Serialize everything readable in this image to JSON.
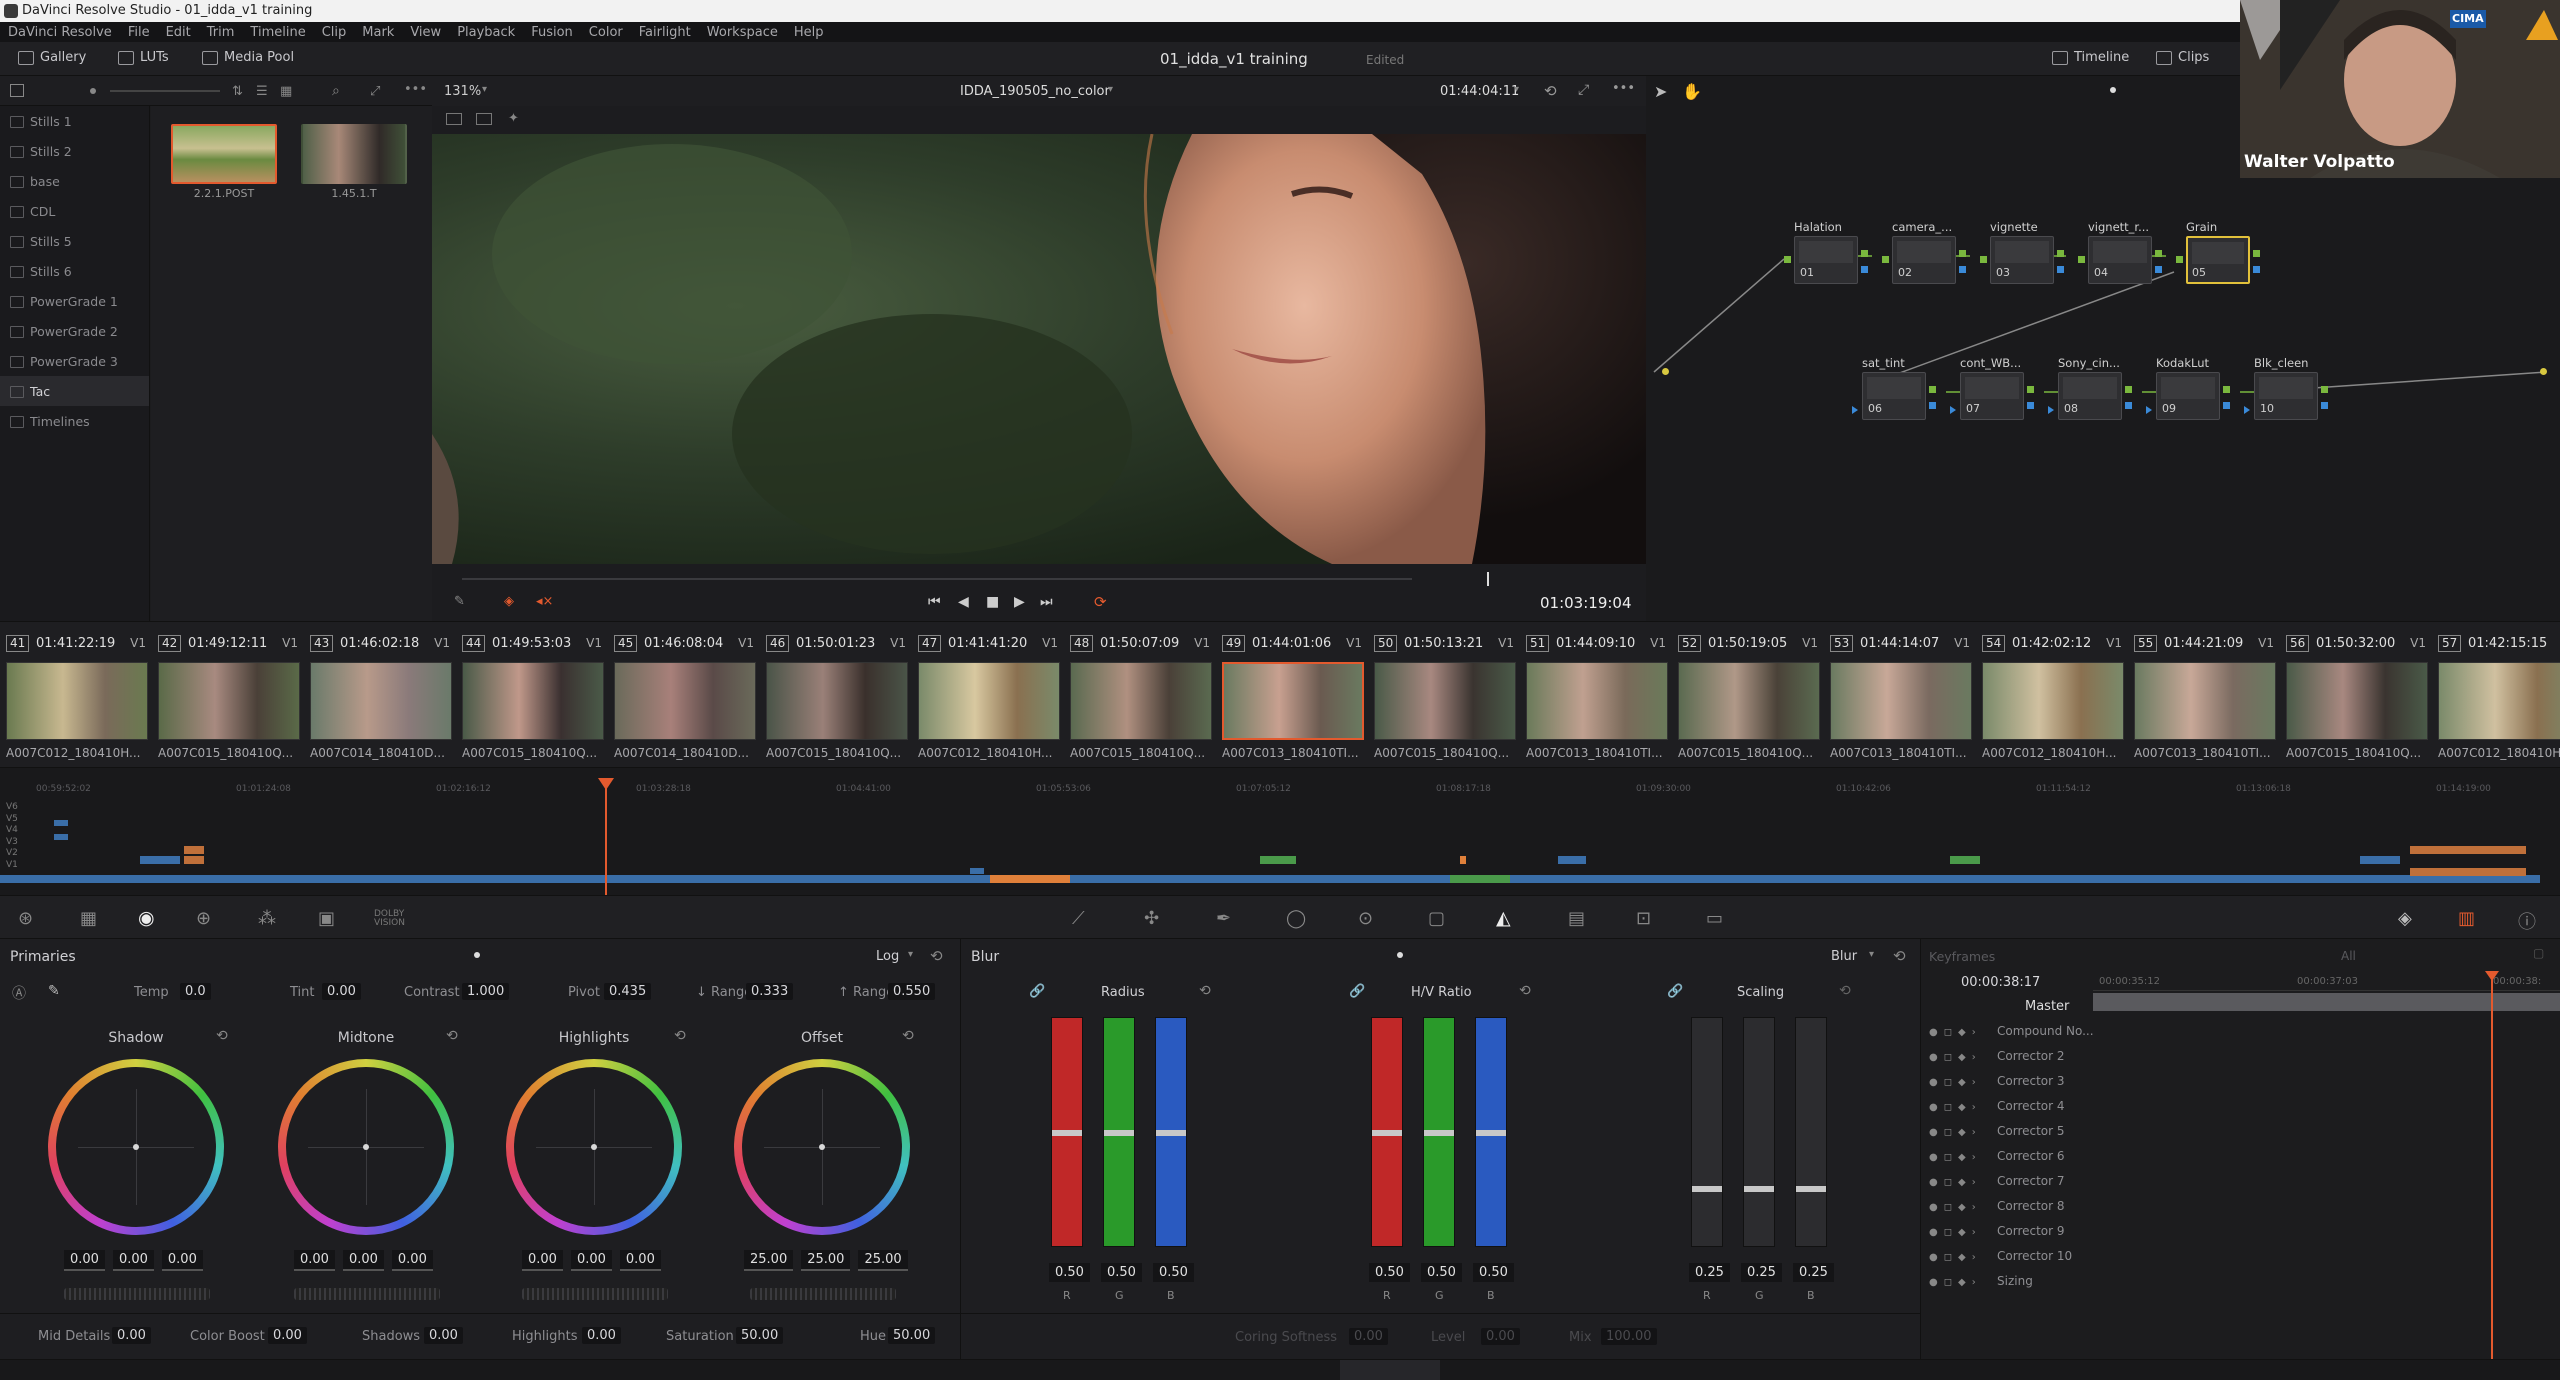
{
  "window": {
    "title": "DaVinci Resolve Studio - 01_idda_v1 training"
  },
  "menu": [
    "DaVinci Resolve",
    "File",
    "Edit",
    "Trim",
    "Timeline",
    "Clip",
    "Mark",
    "View",
    "Playback",
    "Fusion",
    "Color",
    "Fairlight",
    "Workspace",
    "Help"
  ],
  "topbar": {
    "gallery": "Gallery",
    "luts": "LUTs",
    "media_pool": "Media Pool",
    "project_title": "01_idda_v1 training",
    "status": "Edited",
    "timeline": "Timeline",
    "clips": "Clips"
  },
  "viewer": {
    "zoom": "131%",
    "clip_name": "IDDA_190505_no_color",
    "timecode_top": "01:44:04:11",
    "timecode_bottom": "01:03:19:04"
  },
  "albums": [
    "Stills 1",
    "Stills 2",
    "base",
    "CDL",
    "Stills 5",
    "Stills 6",
    "PowerGrade 1",
    "PowerGrade 2",
    "PowerGrade 3",
    "Tac",
    "Timelines"
  ],
  "album_active": "Tac",
  "stills": [
    {
      "label": "2.2.1.POST",
      "selected": true
    },
    {
      "label": "1.45.1.T",
      "selected": false
    }
  ],
  "nodes": [
    {
      "label": "Halation",
      "num": "01"
    },
    {
      "label": "camera_...",
      "num": "02"
    },
    {
      "label": "vignette",
      "num": "03"
    },
    {
      "label": "vignett_r...",
      "num": "04"
    },
    {
      "label": "Grain",
      "num": "05"
    },
    {
      "label": "sat_tint",
      "num": "06"
    },
    {
      "label": "cont_WB...",
      "num": "07"
    },
    {
      "label": "Sony_cin...",
      "num": "08"
    },
    {
      "label": "KodakLut",
      "num": "09"
    },
    {
      "label": "Blk_cleen",
      "num": "10"
    }
  ],
  "webcam": {
    "name": "Walter Volpatto",
    "badge": "CIMA"
  },
  "clips": [
    {
      "num": "41",
      "tc": "01:41:22:19",
      "track": "V1",
      "name": "A007C012_180410H..."
    },
    {
      "num": "42",
      "tc": "01:49:12:11",
      "track": "V1",
      "name": "A007C015_180410Q..."
    },
    {
      "num": "43",
      "tc": "01:46:02:18",
      "track": "V1",
      "name": "A007C014_180410D..."
    },
    {
      "num": "44",
      "tc": "01:49:53:03",
      "track": "V1",
      "name": "A007C015_180410Q..."
    },
    {
      "num": "45",
      "tc": "01:46:08:04",
      "track": "V1",
      "name": "A007C014_180410D..."
    },
    {
      "num": "46",
      "tc": "01:50:01:23",
      "track": "V1",
      "name": "A007C015_180410Q..."
    },
    {
      "num": "47",
      "tc": "01:41:41:20",
      "track": "V1",
      "name": "A007C012_180410H..."
    },
    {
      "num": "48",
      "tc": "01:50:07:09",
      "track": "V1",
      "name": "A007C015_180410Q..."
    },
    {
      "num": "49",
      "tc": "01:44:01:06",
      "track": "V1",
      "name": "A007C013_180410TI..."
    },
    {
      "num": "50",
      "tc": "01:50:13:21",
      "track": "V1",
      "name": "A007C015_180410Q..."
    },
    {
      "num": "51",
      "tc": "01:44:09:10",
      "track": "V1",
      "name": "A007C013_180410TI..."
    },
    {
      "num": "52",
      "tc": "01:50:19:05",
      "track": "V1",
      "name": "A007C015_180410Q..."
    },
    {
      "num": "53",
      "tc": "01:44:14:07",
      "track": "V1",
      "name": "A007C013_180410TI..."
    },
    {
      "num": "54",
      "tc": "01:42:02:12",
      "track": "V1",
      "name": "A007C012_180410H..."
    },
    {
      "num": "55",
      "tc": "01:44:21:09",
      "track": "V1",
      "name": "A007C013_180410TI..."
    },
    {
      "num": "56",
      "tc": "01:50:32:00",
      "track": "V1",
      "name": "A007C015_180410Q..."
    },
    {
      "num": "57",
      "tc": "01:42:15:15",
      "track": "",
      "name": "A007C012_180410H..."
    }
  ],
  "mini_timeline": {
    "ruler": [
      "00:59:52:02",
      "01:01:24:08",
      "01:02:16:12",
      "01:03:28:18",
      "01:04:41:00",
      "01:05:53:06",
      "01:07:05:12",
      "01:08:17:18",
      "01:09:30:00",
      "01:10:42:06",
      "01:11:54:12",
      "01:13:06:18",
      "01:14:19:00"
    ],
    "tracks": [
      "V6",
      "V5",
      "V4",
      "V3",
      "V2",
      "V1"
    ]
  },
  "primaries": {
    "title": "Primaries",
    "mode": "Log",
    "temp_label": "Temp",
    "temp": "0.0",
    "tint_label": "Tint",
    "tint": "0.00",
    "contrast_label": "Contrast",
    "contrast": "1.000",
    "pivot_label": "Pivot",
    "pivot": "0.435",
    "low_range_label": "↓ Range",
    "low_range": "0.333",
    "high_range_label": "↑ Range",
    "high_range": "0.550",
    "wheels": [
      {
        "name": "Shadow",
        "values": [
          "0.00",
          "0.00",
          "0.00"
        ]
      },
      {
        "name": "Midtone",
        "values": [
          "0.00",
          "0.00",
          "0.00"
        ]
      },
      {
        "name": "Highlights",
        "values": [
          "0.00",
          "0.00",
          "0.00"
        ]
      },
      {
        "name": "Offset",
        "values": [
          "25.00",
          "25.00",
          "25.00"
        ]
      }
    ],
    "mid_details_label": "Mid Details",
    "mid_details": "0.00",
    "color_boost_label": "Color Boost",
    "color_boost": "0.00",
    "shadows_label": "Shadows",
    "shadows": "0.00",
    "highlights_label": "Highlights",
    "highlights": "0.00",
    "saturation_label": "Saturation",
    "saturation": "50.00",
    "hue_label": "Hue",
    "hue": "50.00"
  },
  "blur": {
    "title": "Blur",
    "mode": "Blur",
    "groups": [
      {
        "name": "Radius",
        "values": [
          "0.50",
          "0.50",
          "0.50"
        ],
        "level": 0.5
      },
      {
        "name": "H/V Ratio",
        "values": [
          "0.50",
          "0.50",
          "0.50"
        ],
        "level": 0.5
      },
      {
        "name": "Scaling",
        "values": [
          "0.25",
          "0.25",
          "0.25"
        ],
        "level": 0.25
      }
    ],
    "channels": [
      "R",
      "G",
      "B"
    ],
    "coring_softness_label": "Coring Softness",
    "coring_softness": "0.00",
    "level_label": "Level",
    "level": "0.00",
    "mix_label": "Mix",
    "mix": "100.00"
  },
  "keyframes": {
    "title": "Keyframes",
    "filter": "All",
    "timecode": "00:00:38:17",
    "ruler": [
      "00:00:35:12",
      "00:00:37:03",
      "00:00:38:"
    ],
    "rows": [
      "Master",
      "Compound No...",
      "Corrector 2",
      "Corrector 3",
      "Corrector 4",
      "Corrector 5",
      "Corrector 6",
      "Corrector 7",
      "Corrector 8",
      "Corrector 9",
      "Corrector 10",
      "Sizing"
    ]
  }
}
